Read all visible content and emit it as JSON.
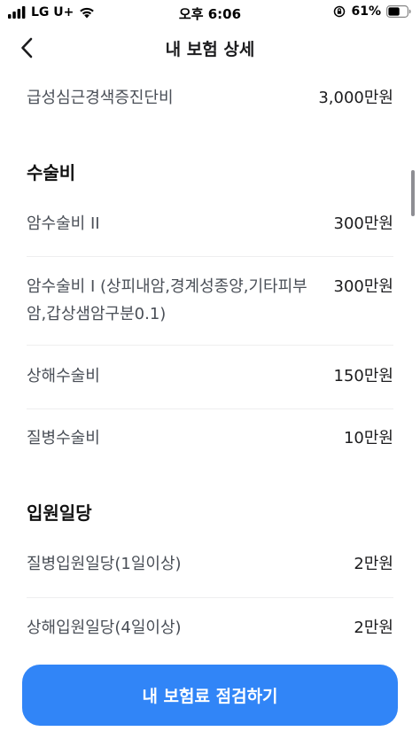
{
  "status_bar": {
    "carrier": "LG U+",
    "time": "오후 6:06",
    "battery_percent": "61%",
    "battery_level": 0.61
  },
  "nav": {
    "back_icon": "chevron-left-icon",
    "title": "내 보험 상세"
  },
  "rows_top": [
    {
      "label": "급성심근경색증진단비",
      "value": "3,000만원"
    }
  ],
  "sections": [
    {
      "title": "수술비",
      "rows": [
        {
          "label": "암수술비 II",
          "value": "300만원"
        },
        {
          "label": "암수술비 I (상피내암,경계성종양,기타피부암,갑상샘암구분0.1)",
          "value": "300만원"
        },
        {
          "label": "상해수술비",
          "value": "150만원"
        },
        {
          "label": "질병수술비",
          "value": "10만원"
        }
      ]
    },
    {
      "title": "입원일당",
      "rows": [
        {
          "label": "질병입원일당(1일이상)",
          "value": "2만원"
        },
        {
          "label": "상해입원일당(4일이상)",
          "value": "2만원"
        }
      ]
    }
  ],
  "cta": {
    "label": "내 보험료 점검하기"
  },
  "colors": {
    "accent": "#3185f7",
    "text": "#1c1c1e",
    "label": "#4a4f57"
  }
}
